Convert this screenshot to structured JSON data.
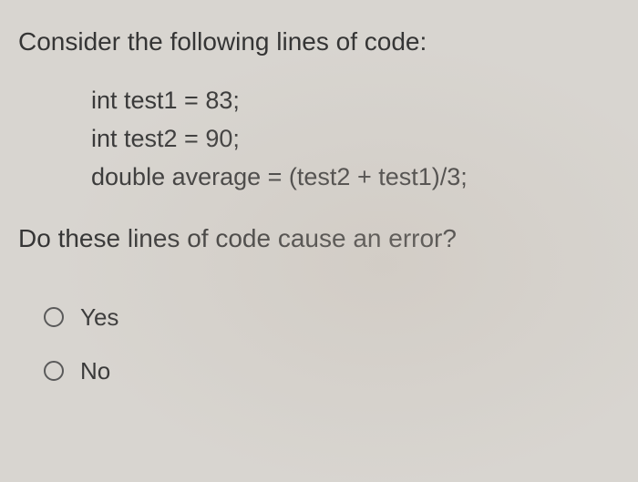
{
  "question": {
    "prompt": "Consider the following lines of code:",
    "code": [
      "int test1 = 83;",
      "int test2 = 90;",
      "double average = (test2 + test1)/3;"
    ],
    "followup": "Do these lines of code cause an error?"
  },
  "options": [
    {
      "label": "Yes"
    },
    {
      "label": "No"
    }
  ]
}
